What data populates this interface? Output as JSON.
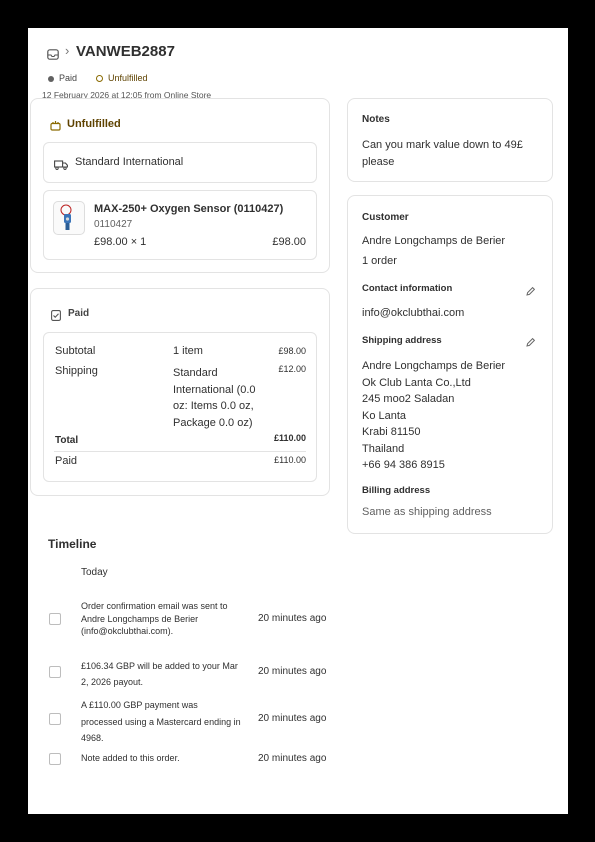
{
  "header": {
    "order_id": "VANWEB2887",
    "paid_badge": "Paid",
    "unfulfilled_badge": "Unfulfilled",
    "date_line": "12 February 2026 at 12:05 from Online Store"
  },
  "fulfillment": {
    "status": "Unfulfilled",
    "shipping_method": "Standard International",
    "item": {
      "title": "MAX-250+ Oxygen Sensor (0110427)",
      "sku": "0110427",
      "price_qty": "£98.00 × 1",
      "total": "£98.00"
    }
  },
  "payment": {
    "status": "Paid",
    "rows": [
      {
        "label": "Subtotal",
        "desc": "1 item",
        "amount": "£98.00"
      },
      {
        "label": "Shipping",
        "desc": "Standard International (0.0 oz: Items 0.0 oz, Package 0.0 oz)",
        "amount": "£12.00"
      },
      {
        "label": "Total",
        "desc": "",
        "amount": "£110.00"
      },
      {
        "label": "Paid",
        "desc": "",
        "amount": "£110.00"
      }
    ]
  },
  "notes": {
    "title": "Notes",
    "text": "Can you mark value down to 49£ please"
  },
  "customer": {
    "title": "Customer",
    "name": "Andre Longchamps de Berier",
    "orders": "1 order",
    "contact_title": "Contact information",
    "email": "info@okclubthai.com",
    "shipping_title": "Shipping address",
    "address": [
      "Andre Longchamps de Berier",
      "Ok Club Lanta Co.,Ltd",
      "245 moo2 Saladan",
      "Ko Lanta",
      "Krabi 81150",
      "Thailand",
      "+66 94 386 8915"
    ],
    "billing_title": "Billing address",
    "billing_text": "Same as shipping address"
  },
  "timeline": {
    "title": "Timeline",
    "today": "Today",
    "events": [
      {
        "text": "Order confirmation email was sent to Andre Longchamps de Berier (info@okclubthai.com).",
        "time": "20 minutes ago"
      },
      {
        "text": "£106.34 GBP will be added to your Mar 2, 2026 payout.",
        "time": "20 minutes ago"
      },
      {
        "text": "A £110.00 GBP payment was processed using a Mastercard ending in 4968.",
        "time": "20 minutes ago"
      },
      {
        "text": "Note added to this order.",
        "time": "20 minutes ago"
      }
    ]
  },
  "colors": {
    "unfulfilled": "#5e4200",
    "paid_dot": "#616161",
    "border": "#e3e3e3"
  }
}
